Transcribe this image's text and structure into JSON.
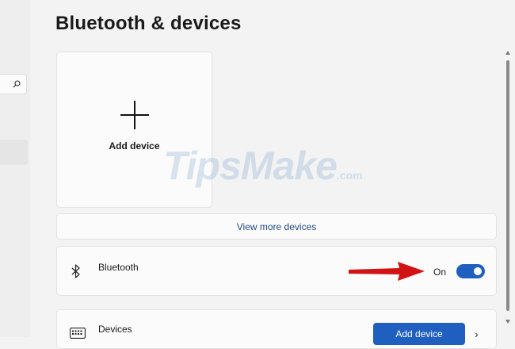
{
  "page": {
    "title": "Bluetooth & devices"
  },
  "sidebar": {
    "search_icon": "search-icon"
  },
  "add_card": {
    "label": "Add device"
  },
  "more_devices": {
    "label": "View more devices"
  },
  "bluetooth": {
    "label": "Bluetooth",
    "state": "On",
    "enabled": true
  },
  "devices": {
    "label": "Devices",
    "button_label": "Add device"
  },
  "watermark": {
    "brand": "TipsMake",
    "suffix": ".com"
  },
  "colors": {
    "accent": "#1f5fbf",
    "annotation_arrow": "#d11313",
    "background": "#f3f3f3"
  }
}
